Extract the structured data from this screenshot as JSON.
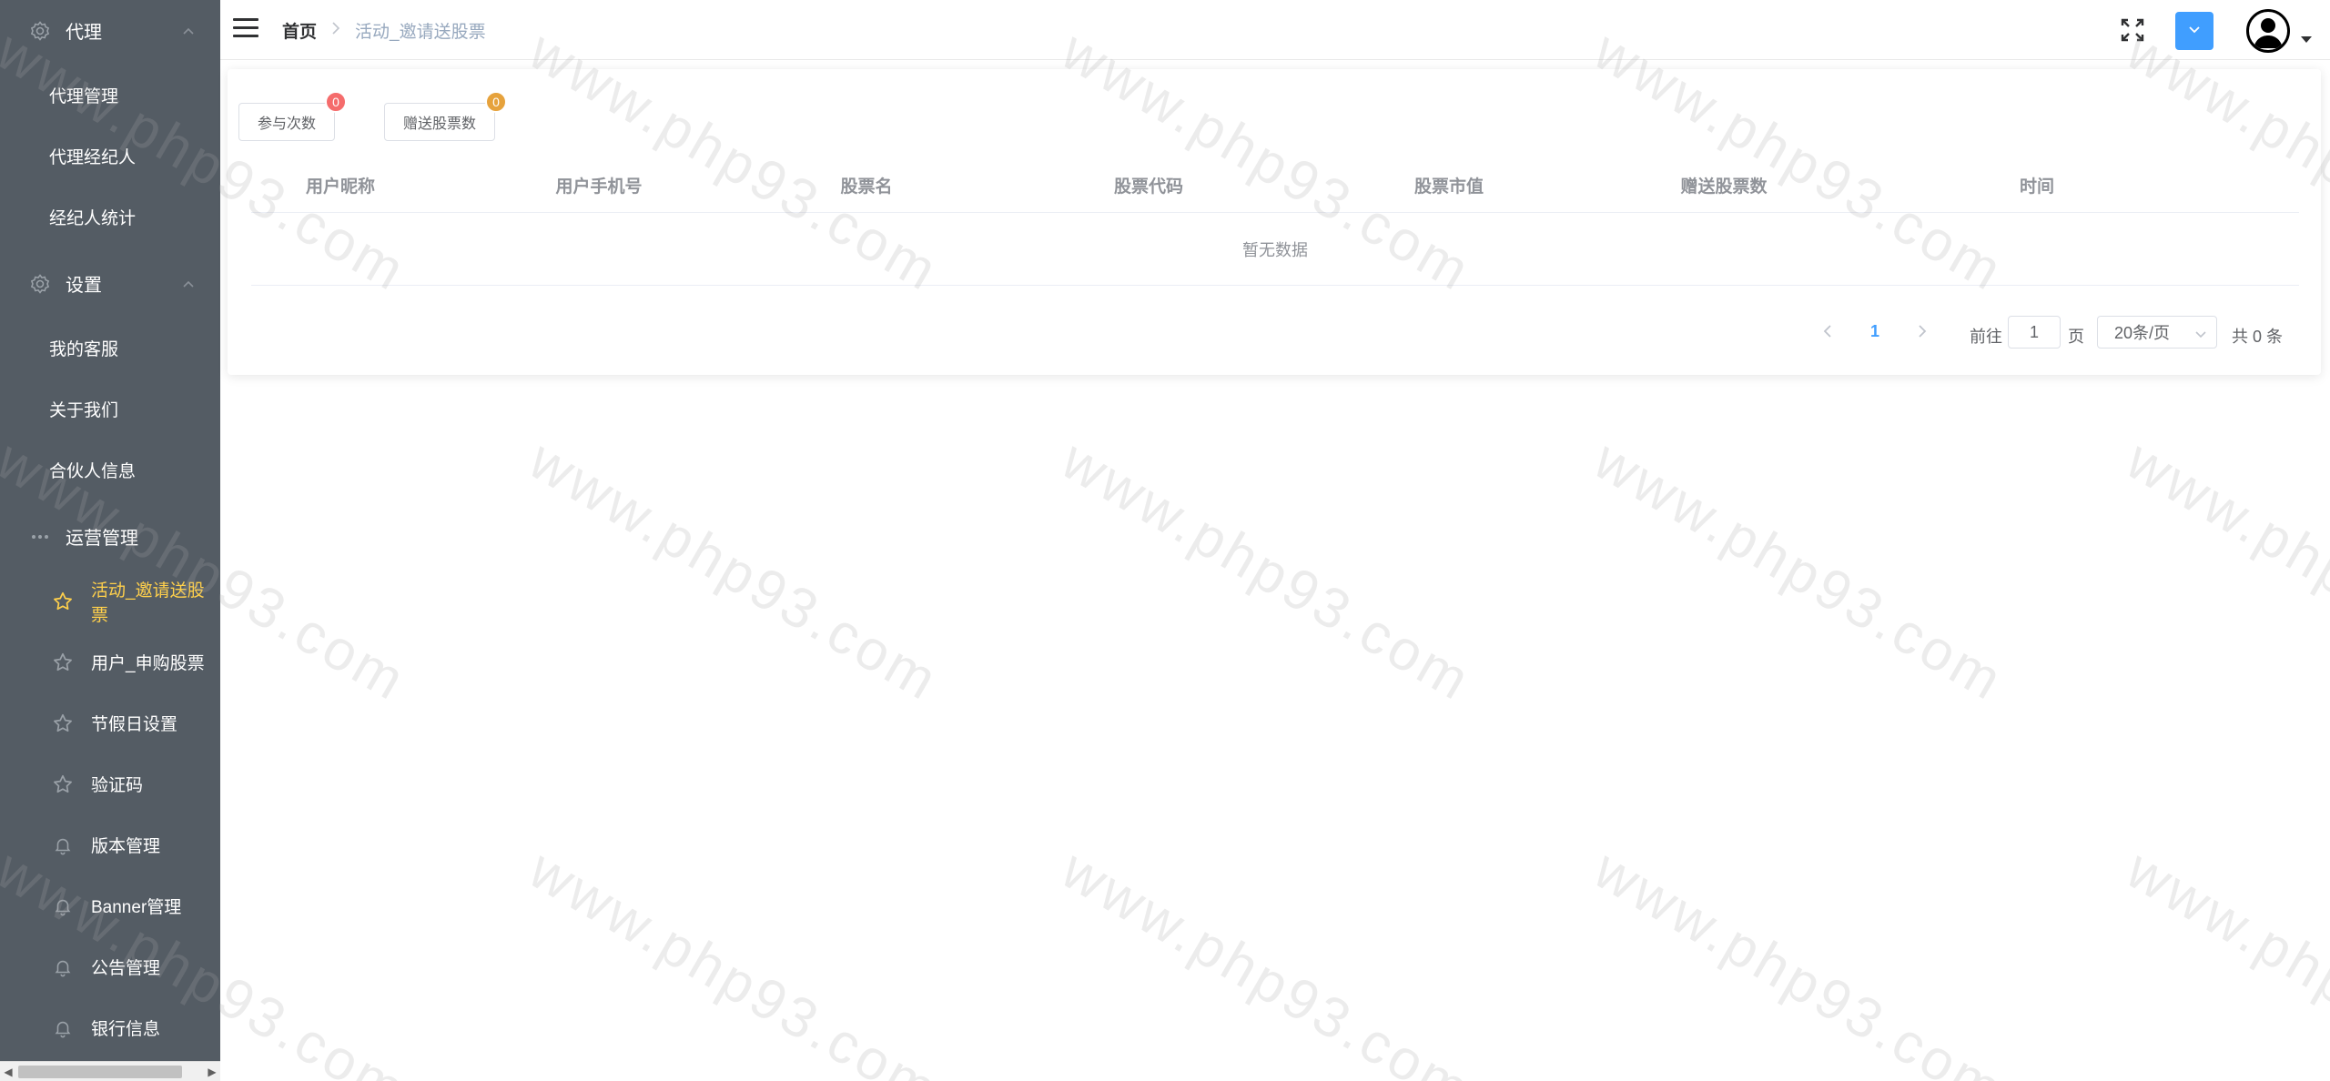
{
  "sidebar": {
    "groups": [
      {
        "label": "代理",
        "icon": "gear-icon"
      },
      {
        "label": "设置",
        "icon": "gear-icon"
      },
      {
        "label": "运营管理",
        "icon": "more-icon"
      }
    ],
    "agent_items": [
      "代理管理",
      "代理经纪人",
      "经纪人统计"
    ],
    "settings_items": [
      "我的客服",
      "关于我们",
      "合伙人信息"
    ],
    "ops_items": [
      {
        "label": "活动_邀请送股票",
        "icon": "star-icon",
        "active": true
      },
      {
        "label": "用户_申购股票",
        "icon": "star-icon"
      },
      {
        "label": "节假日设置",
        "icon": "star-icon"
      },
      {
        "label": "验证码",
        "icon": "star-icon"
      },
      {
        "label": "版本管理",
        "icon": "bell-icon"
      },
      {
        "label": "Banner管理",
        "icon": "bell-icon"
      },
      {
        "label": "公告管理",
        "icon": "bell-icon"
      },
      {
        "label": "银行信息",
        "icon": "bell-icon"
      }
    ],
    "active_color": "#ffd04b",
    "background": "#545c64"
  },
  "header": {
    "breadcrumb_home": "首页",
    "breadcrumb_current": "活动_邀请送股票"
  },
  "stats": {
    "participations_label": "参与次数",
    "participations_count": "0",
    "gifted_shares_label": "赠送股票数",
    "gifted_shares_count": "0"
  },
  "table": {
    "columns": [
      "用户昵称",
      "用户手机号",
      "股票名",
      "股票代码",
      "股票市值",
      "赠送股票数",
      "时间"
    ],
    "empty_text": "暂无数据"
  },
  "pagination": {
    "current_page": "1",
    "goto_label": "前往",
    "goto_value": "1",
    "page_suffix": "页",
    "page_size": "20条/页",
    "total": "共 0 条"
  },
  "watermark": "www.php93.com"
}
